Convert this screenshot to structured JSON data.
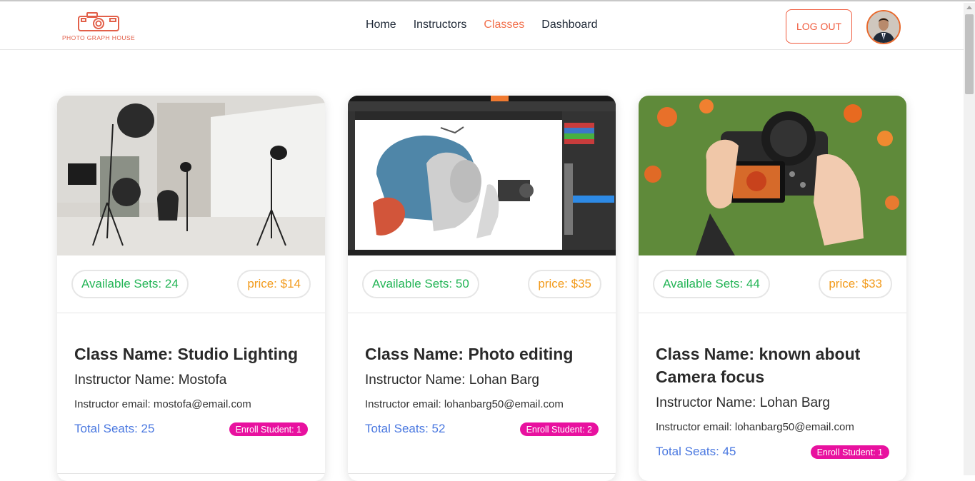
{
  "brand": {
    "logo_text": "PHOTO GRAPH HOUSE",
    "accent": "#f2704c"
  },
  "nav": {
    "items": [
      {
        "label": "Home",
        "active": false
      },
      {
        "label": "Instructors",
        "active": false
      },
      {
        "label": "Classes",
        "active": true
      },
      {
        "label": "Dashboard",
        "active": false
      }
    ],
    "logout_label": "LOG OUT",
    "avatar_icon": "user-avatar"
  },
  "classes": [
    {
      "image_icon": "studio-lighting-photo",
      "available_sets": "Available Sets: 24",
      "price": "price: $14",
      "class_name": "Class Name: Studio Lighting",
      "instructor_name": "Instructor Name: Mostofa",
      "instructor_email": "Instructor email: mostofa@email.com",
      "total_seats": "Total Seats: 25",
      "enroll": "Enroll Student: 1"
    },
    {
      "image_icon": "photo-editing-screenshot",
      "available_sets": "Available Sets: 50",
      "price": "price: $35",
      "class_name": "Class Name: Photo editing",
      "instructor_name": "Instructor Name: Lohan Barg",
      "instructor_email": "Instructor email: lohanbarg50@email.com",
      "total_seats": "Total Seats: 52",
      "enroll": "Enroll Student: 2"
    },
    {
      "image_icon": "camera-focus-photo",
      "available_sets": "Available Sets: 44",
      "price": "price: $33",
      "class_name": "Class Name: known about Camera focus",
      "instructor_name": "Instructor Name: Lohan Barg",
      "instructor_email": "Instructor email: lohanbarg50@email.com",
      "total_seats": "Total Seats: 45",
      "enroll": "Enroll Student: 1"
    }
  ]
}
